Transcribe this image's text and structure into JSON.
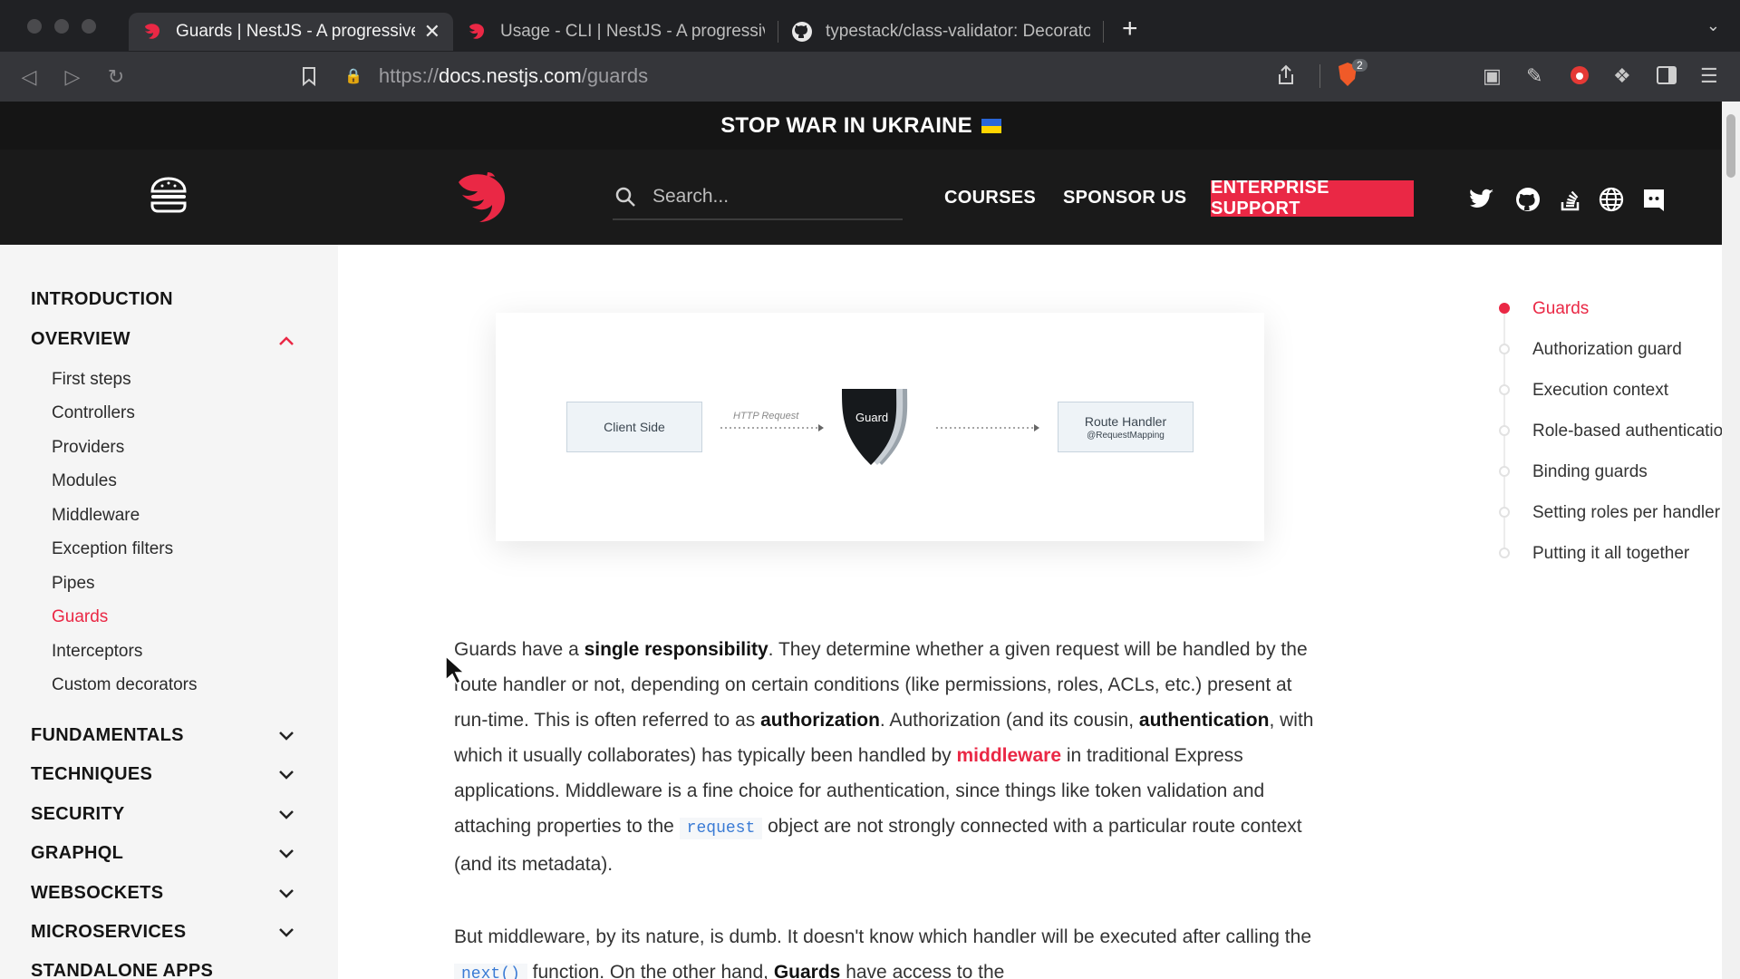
{
  "browser": {
    "tabs": [
      {
        "title": "Guards | NestJS - A progressive",
        "icon": "nestjs-favicon-icon",
        "active": true
      },
      {
        "title": "Usage - CLI | NestJS - A progressive",
        "icon": "nestjs-favicon-icon",
        "active": false
      },
      {
        "title": "typestack/class-validator: Decorato",
        "icon": "github-favicon-icon",
        "active": false
      }
    ],
    "close_tab": "✕",
    "new_tab": "+",
    "url_scheme": "https://",
    "url_host": "docs.nestjs.com",
    "url_path": "/guards",
    "brave_badge": "2"
  },
  "site": {
    "banner": "STOP WAR IN UKRAINE",
    "search_placeholder": "Search...",
    "nav": {
      "courses": "COURSES",
      "sponsor": "SPONSOR US",
      "enterprise": "ENTERPRISE SUPPORT"
    },
    "accent": "#ea2845"
  },
  "sidebar": {
    "sections": [
      {
        "label": "INTRODUCTION"
      },
      {
        "label": "OVERVIEW",
        "expanded": true
      },
      {
        "label": "FUNDAMENTALS"
      },
      {
        "label": "TECHNIQUES"
      },
      {
        "label": "SECURITY"
      },
      {
        "label": "GRAPHQL"
      },
      {
        "label": "WEBSOCKETS"
      },
      {
        "label": "MICROSERVICES"
      },
      {
        "label": "STANDALONE APPS"
      }
    ],
    "overview_items": [
      {
        "label": "First steps"
      },
      {
        "label": "Controllers"
      },
      {
        "label": "Providers"
      },
      {
        "label": "Modules"
      },
      {
        "label": "Middleware"
      },
      {
        "label": "Exception filters"
      },
      {
        "label": "Pipes"
      },
      {
        "label": "Guards",
        "active": true
      },
      {
        "label": "Interceptors"
      },
      {
        "label": "Custom decorators"
      }
    ]
  },
  "diagram": {
    "client": "Client Side",
    "request": "HTTP Request",
    "guard": "Guard",
    "handler": "Route Handler",
    "handler_sub": "@RequestMapping"
  },
  "article": {
    "p1": {
      "a": "Guards have a ",
      "b": "single responsibility",
      "c": ". They determine whether a given request will be handled by the route handler or not, depending on certain conditions (like permissions, roles, ACLs, etc.) present at run-time. This is often referred to as ",
      "d": "authorization",
      "e": ". Authorization (and its cousin, ",
      "f": "authentication",
      "g": ", with which it usually collaborates) has typically been handled by ",
      "h": "middleware",
      "i": " in traditional Express applications. Middleware is a fine choice for authentication, since things like token validation and attaching properties to the ",
      "j": "request",
      "k": " object are not strongly connected with a particular route context (and its metadata)."
    },
    "p2": {
      "a": "But middleware, by its nature, is dumb. It doesn't know which handler will be executed after calling the ",
      "b": "next()",
      "c": " function. On the other hand, ",
      "d": "Guards",
      "e": " have access to the"
    }
  },
  "toc": [
    {
      "label": "Guards",
      "active": true
    },
    {
      "label": "Authorization guard"
    },
    {
      "label": "Execution context"
    },
    {
      "label": "Role-based authentication"
    },
    {
      "label": "Binding guards"
    },
    {
      "label": "Setting roles per handler"
    },
    {
      "label": "Putting it all together"
    }
  ]
}
